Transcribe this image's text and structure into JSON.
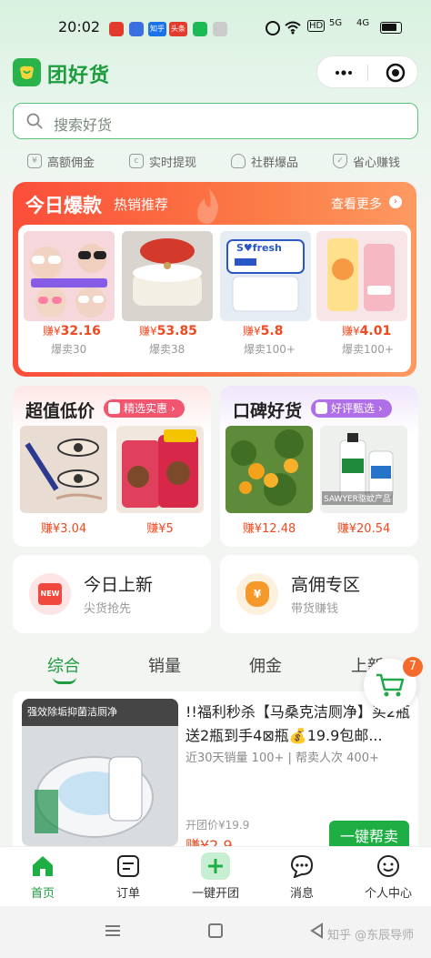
{
  "status_bar": {
    "time": "20:02",
    "app_badges": [
      "知乎",
      "头条"
    ],
    "right_labels": [
      "HD",
      "5G",
      "4G"
    ]
  },
  "header": {
    "app_name": "团好货",
    "menu_icon": "more-dots-icon",
    "close_icon": "target-icon"
  },
  "search": {
    "placeholder": "搜索好货"
  },
  "features": [
    "高额佣金",
    "实时提现",
    "社群爆品",
    "省心赚钱"
  ],
  "hot": {
    "title": "今日爆款",
    "subtitle": "热销推荐",
    "more": "查看更多",
    "products": [
      {
        "price_prefix": "赚¥",
        "price": "32.16",
        "sold": "爆卖30",
        "img_label": ""
      },
      {
        "price_prefix": "赚¥",
        "price": "53.85",
        "sold": "爆卖38",
        "img_label": ""
      },
      {
        "price_prefix": "赚¥",
        "price": "5.8",
        "sold": "爆卖100+",
        "img_label": "S♥fresh"
      },
      {
        "price_prefix": "赚¥",
        "price": "4.01",
        "sold": "爆卖100+",
        "img_label": ""
      }
    ]
  },
  "value_card": {
    "title": "超值低价",
    "badge": "精选实惠",
    "products": [
      {
        "price": "赚¥3.04"
      },
      {
        "price": "赚¥5"
      }
    ]
  },
  "praise_card": {
    "title": "口碑好货",
    "badge": "好评甄选",
    "products": [
      {
        "price": "赚¥12.48"
      },
      {
        "price": "赚¥20.54",
        "img_label": "SAWYER驱蚊产品"
      }
    ]
  },
  "banners": [
    {
      "title": "今日上新",
      "subtitle": "尖货抢先",
      "icon_text": "NEW"
    },
    {
      "title": "高佣专区",
      "subtitle": "带货赚钱",
      "icon_text": "¥"
    }
  ],
  "tabs": [
    "综合",
    "销量",
    "佣金",
    "上新"
  ],
  "cart": {
    "count": "7"
  },
  "item": {
    "title": "!!福利秒杀【马桑克洁厕净】买2瓶送2瓶到手4⊠瓶💰19.9包邮...",
    "meta": "近30天销量 100+ | 帮卖人次 400+",
    "group_price": "开团价¥19.9",
    "earn": "赚¥2.9",
    "button": "一键帮卖",
    "img_label": "强效除垢抑菌洁厕净"
  },
  "nav": [
    {
      "label": "首页",
      "icon": "home-icon",
      "active": true
    },
    {
      "label": "订单",
      "icon": "order-icon",
      "active": false
    },
    {
      "label": "一键开团",
      "icon": "plus-icon",
      "active": false
    },
    {
      "label": "消息",
      "icon": "message-icon",
      "active": false
    },
    {
      "label": "个人中心",
      "icon": "profile-icon",
      "active": false
    }
  ],
  "watermark": "知乎 @东辰导师",
  "colors": {
    "brand_green": "#1c9d3d",
    "hot_orange": "#fb4e3a",
    "price_red": "#f0491f"
  }
}
